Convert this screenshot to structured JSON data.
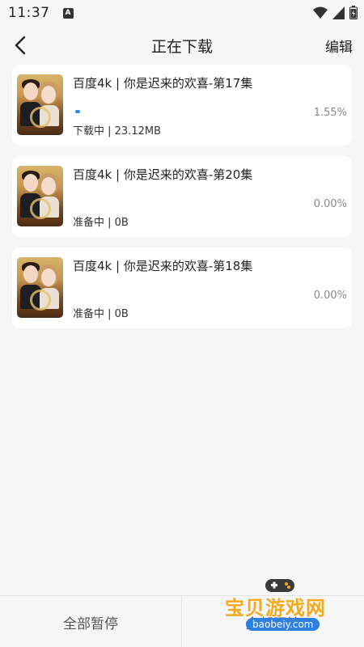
{
  "status_bar": {
    "time": "11:37",
    "notif_icon_letter": "A"
  },
  "header": {
    "title": "正在下载",
    "edit_label": "编辑"
  },
  "downloads": [
    {
      "title": "百度4k | 你是迟来的欢喜-第17集",
      "percent": "1.55%",
      "status": "下载中 | 23.12MB",
      "progress_fraction": 0.0155
    },
    {
      "title": "百度4k | 你是迟来的欢喜-第20集",
      "percent": "0.00%",
      "status": "准备中 | 0B",
      "progress_fraction": 0
    },
    {
      "title": "百度4k | 你是迟来的欢喜-第18集",
      "percent": "0.00%",
      "status": "准备中 | 0B",
      "progress_fraction": 0
    }
  ],
  "bottom": {
    "pause_all": "全部暂停",
    "start_all": "全部开始"
  },
  "watermark": {
    "brand": "宝贝游戏网",
    "url": "baobeiy.com"
  },
  "colors": {
    "accent": "#2a8cf3",
    "background": "#f6f6f6"
  }
}
